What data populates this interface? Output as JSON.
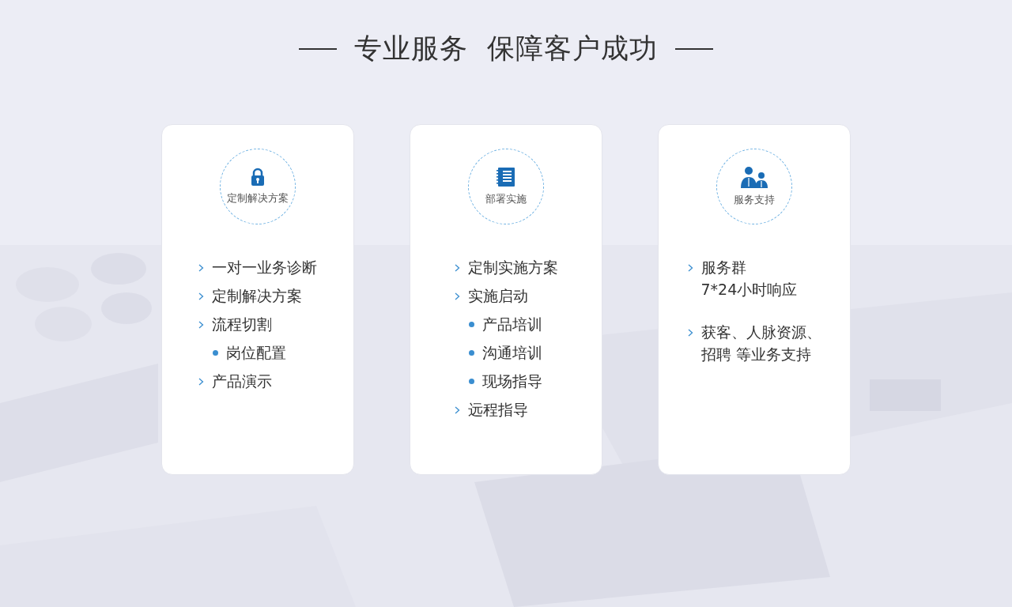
{
  "heading": "专业服务  保障客户成功",
  "cards": [
    {
      "kind": "lock",
      "label": "定制解决方案",
      "items": [
        {
          "kind": "chevron",
          "lines": [
            "一对一业务诊断"
          ]
        },
        {
          "kind": "chevron",
          "lines": [
            "定制解决方案"
          ]
        },
        {
          "kind": "chevron",
          "lines": [
            "流程切割"
          ]
        },
        {
          "kind": "bullet",
          "lines": [
            "岗位配置"
          ]
        },
        {
          "kind": "chevron",
          "lines": [
            "产品演示"
          ]
        }
      ]
    },
    {
      "kind": "notebook",
      "label": "部署实施",
      "items": [
        {
          "kind": "chevron",
          "lines": [
            "定制实施方案"
          ]
        },
        {
          "kind": "chevron",
          "lines": [
            "实施启动"
          ]
        },
        {
          "kind": "bullet",
          "lines": [
            "产品培训"
          ]
        },
        {
          "kind": "bullet",
          "lines": [
            "沟通培训"
          ]
        },
        {
          "kind": "bullet",
          "lines": [
            "现场指导"
          ]
        },
        {
          "kind": "chevron",
          "lines": [
            "远程指导"
          ]
        }
      ]
    },
    {
      "kind": "people",
      "label": "服务支持",
      "items": [
        {
          "kind": "chevron",
          "lines": [
            "服务群",
            "7*24小时响应"
          ]
        },
        {
          "kind": "chevron",
          "lines": [
            "获客、人脉资源、",
            "招聘 等业务支持"
          ]
        }
      ]
    }
  ]
}
